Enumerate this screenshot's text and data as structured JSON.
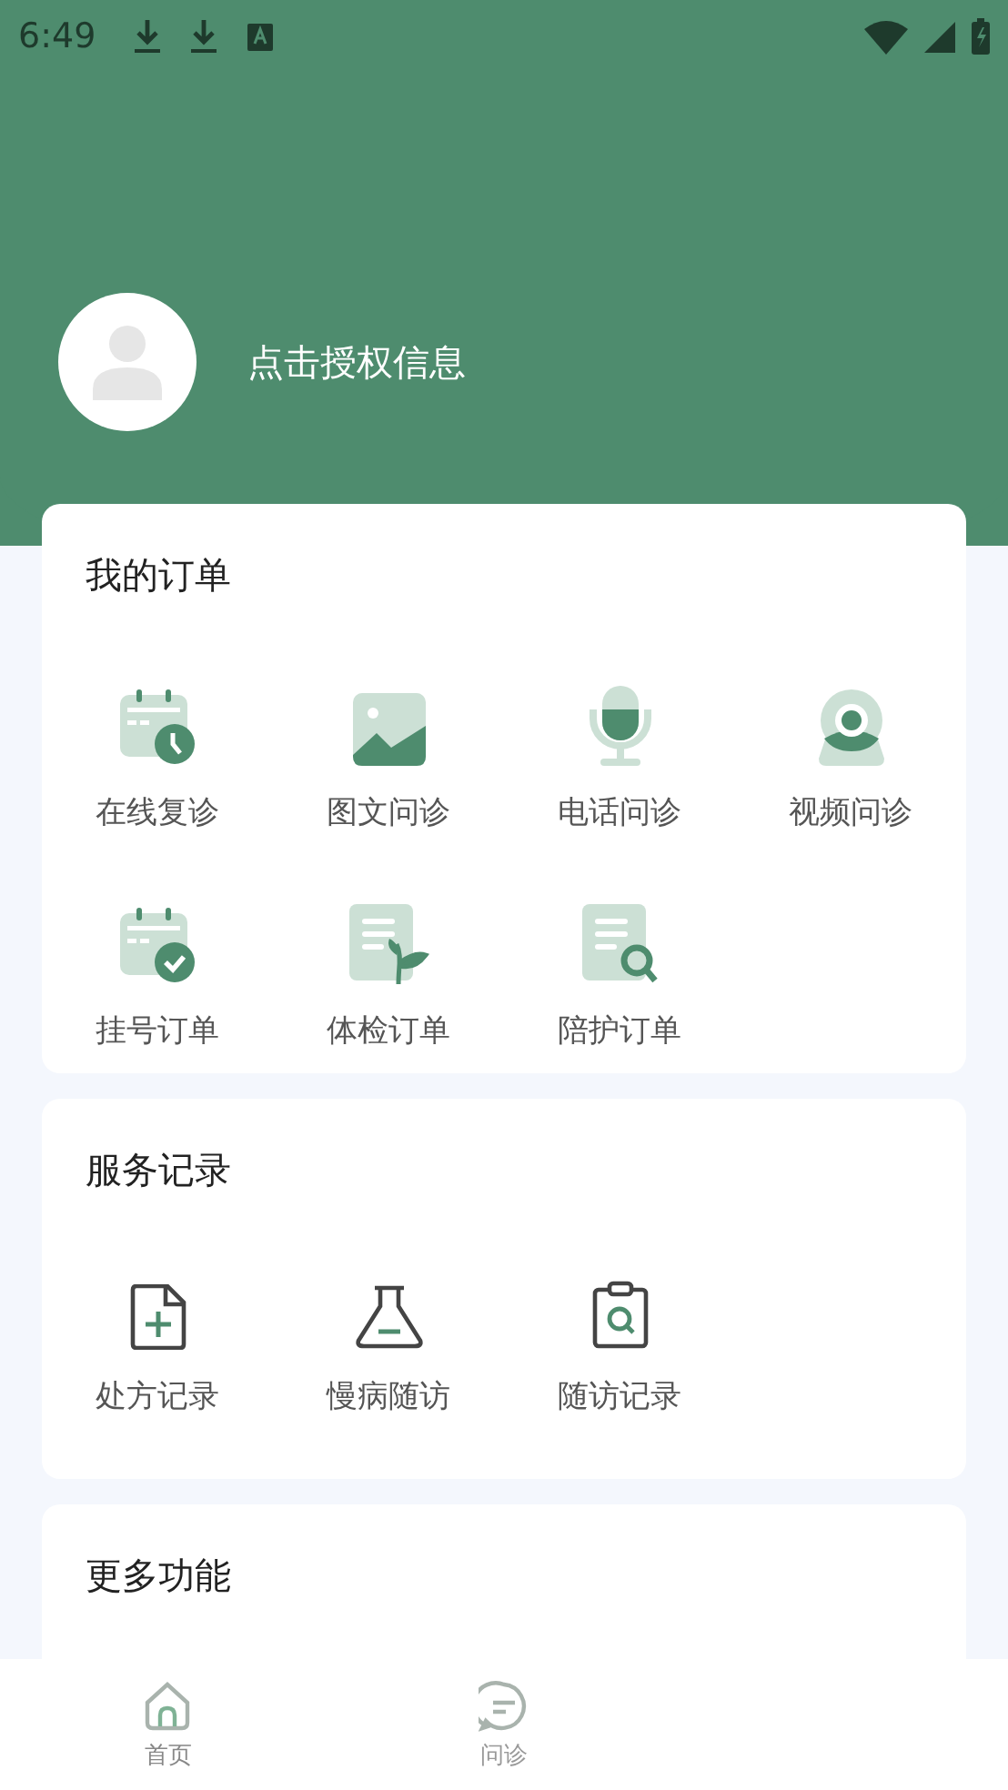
{
  "status_bar": {
    "time": "6:49"
  },
  "profile": {
    "login_prompt": "点击授权信息"
  },
  "orders": {
    "title": "我的订单",
    "items": [
      {
        "label": "在线复诊",
        "kind": "calendar-clock"
      },
      {
        "label": "图文问诊",
        "kind": "image"
      },
      {
        "label": "电话问诊",
        "kind": "microphone"
      },
      {
        "label": "视频问诊",
        "kind": "webcam"
      },
      {
        "label": "挂号订单",
        "kind": "calendar-check"
      },
      {
        "label": "体检订单",
        "kind": "document-leaf"
      },
      {
        "label": "陪护订单",
        "kind": "document-search"
      }
    ]
  },
  "services": {
    "title": "服务记录",
    "items": [
      {
        "label": "处方记录",
        "kind": "document-plus"
      },
      {
        "label": "慢病随访",
        "kind": "flask"
      },
      {
        "label": "随访记录",
        "kind": "clipboard-search"
      }
    ]
  },
  "more": {
    "title": "更多功能"
  },
  "bottom_nav": [
    {
      "label": "首页",
      "kind": "home",
      "selected": true
    },
    {
      "label": "问诊",
      "kind": "chat",
      "selected": false
    }
  ]
}
